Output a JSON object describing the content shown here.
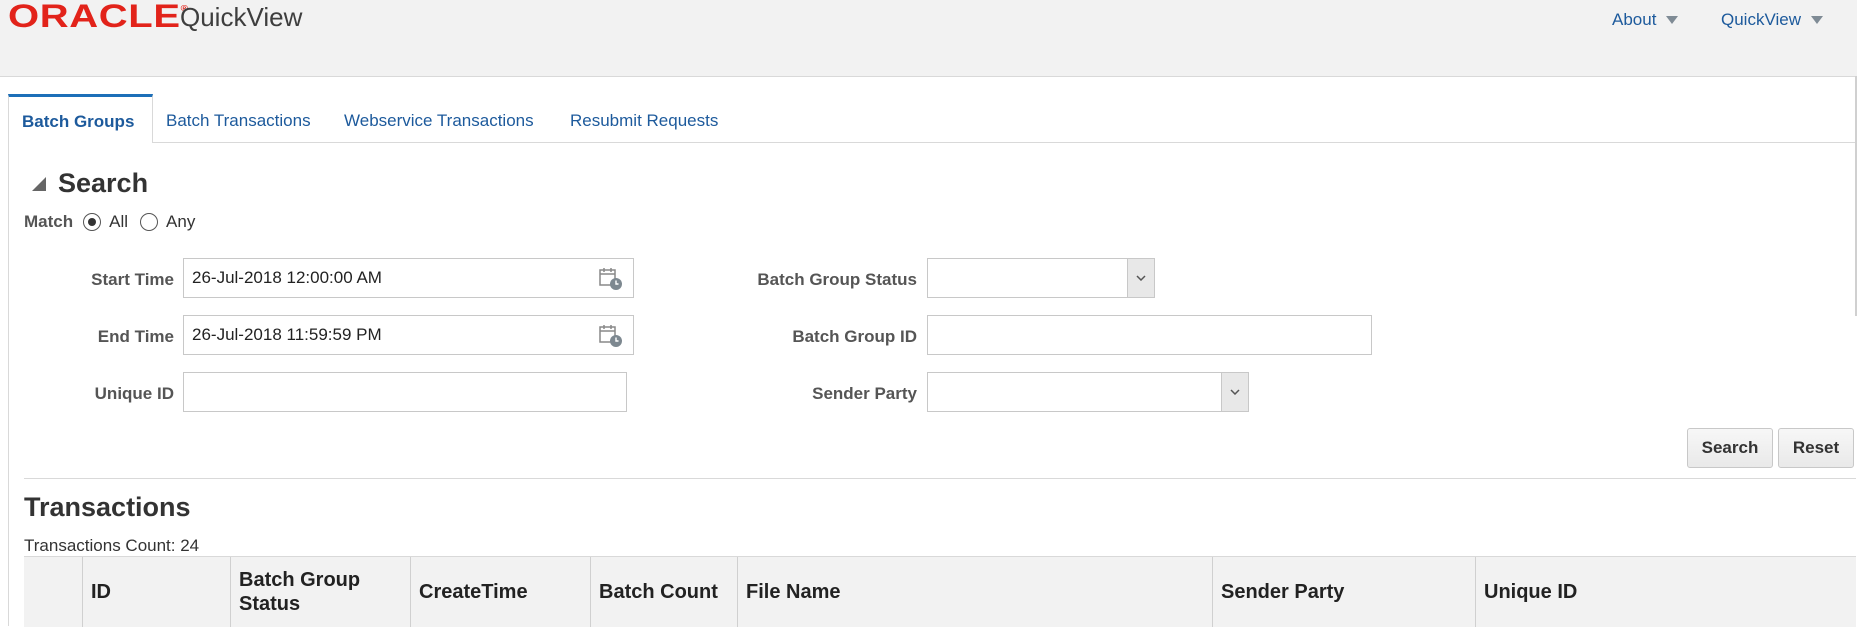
{
  "header": {
    "logo_text": "ORACLE",
    "app_name": "QuickView",
    "nav": [
      {
        "label": "About"
      },
      {
        "label": "QuickView"
      }
    ]
  },
  "tabs": [
    {
      "label": "Batch Groups",
      "active": true
    },
    {
      "label": "Batch Transactions",
      "active": false
    },
    {
      "label": "Webservice Transactions",
      "active": false
    },
    {
      "label": "Resubmit Requests",
      "active": false
    }
  ],
  "search": {
    "title": "Search",
    "match_label": "Match",
    "match_options": [
      {
        "label": "All",
        "selected": true
      },
      {
        "label": "Any",
        "selected": false
      }
    ],
    "start_time": {
      "label": "Start Time",
      "value": "26-Jul-2018 12:00:00 AM"
    },
    "end_time": {
      "label": "End Time",
      "value": "26-Jul-2018 11:59:59 PM"
    },
    "unique_id": {
      "label": "Unique ID",
      "value": ""
    },
    "batch_group_status": {
      "label": "Batch Group Status",
      "value": ""
    },
    "batch_group_id": {
      "label": "Batch Group ID",
      "value": ""
    },
    "sender_party": {
      "label": "Sender Party",
      "value": ""
    },
    "search_button": "Search",
    "reset_button": "Reset"
  },
  "transactions": {
    "title": "Transactions",
    "count_text": "Transactions Count: 24",
    "columns": [
      "",
      "ID",
      "Batch Group Status",
      "CreateTime",
      "Batch Count",
      "File Name",
      "Sender Party",
      "Unique ID"
    ]
  },
  "colors": {
    "brand_red": "#e2231a",
    "link_blue": "#1d5a9c",
    "active_tab_border": "#1d6fb8"
  }
}
